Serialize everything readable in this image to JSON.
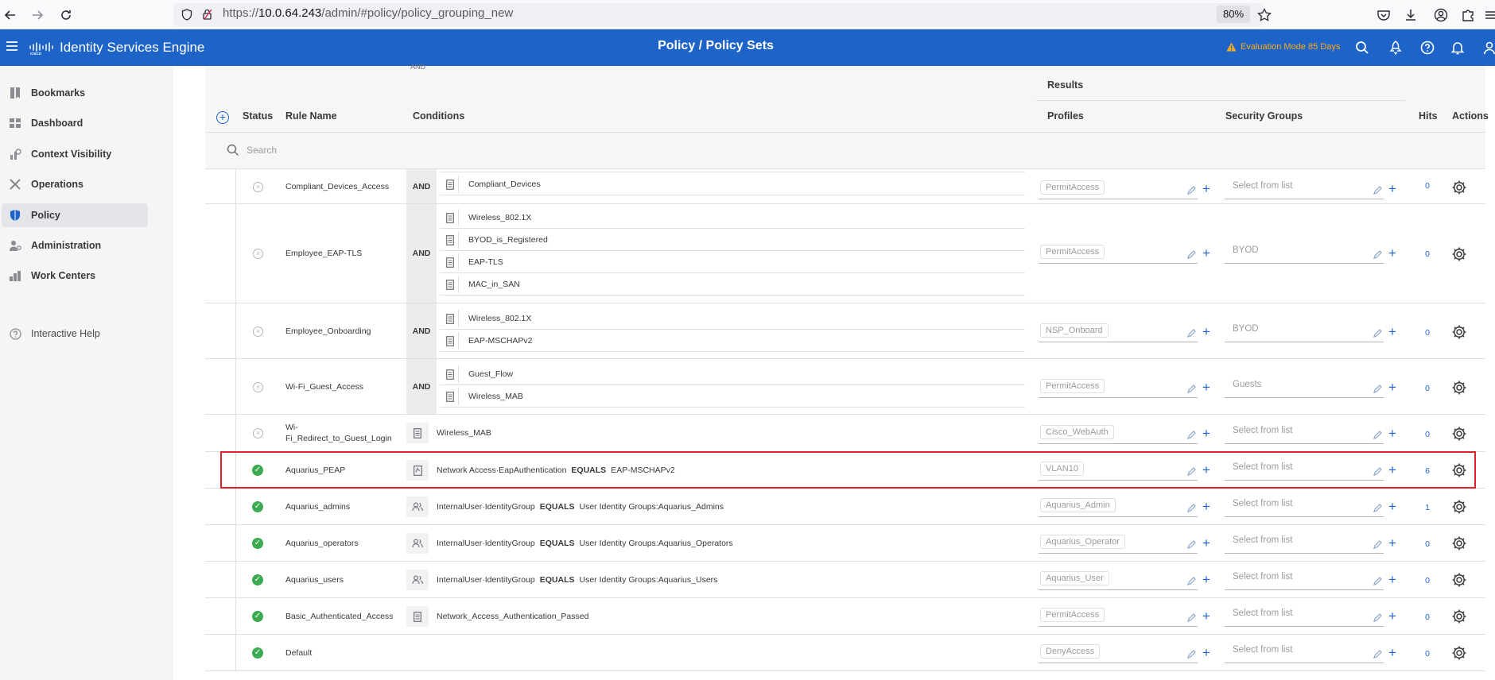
{
  "browser": {
    "url_prefix": "https://",
    "url_host": "10.0.64.243",
    "url_path": "/admin/#policy/policy_grouping_new",
    "zoom": "80%"
  },
  "header": {
    "app_title": "Identity Services Engine",
    "page_title": "Policy / Policy Sets",
    "evaluation": "Evaluation Mode 85 Days"
  },
  "sidebar": {
    "items": [
      {
        "label": "Bookmarks"
      },
      {
        "label": "Dashboard"
      },
      {
        "label": "Context Visibility"
      },
      {
        "label": "Operations"
      },
      {
        "label": "Policy"
      },
      {
        "label": "Administration"
      },
      {
        "label": "Work Centers"
      }
    ],
    "help_label": "Interactive Help"
  },
  "table": {
    "partial_top_text": "AND",
    "headers": {
      "results": "Results",
      "status": "Status",
      "rule_name": "Rule Name",
      "conditions": "Conditions",
      "profiles": "Profiles",
      "security_groups": "Security Groups",
      "hits": "Hits",
      "actions": "Actions"
    },
    "search_placeholder": "Search",
    "rows": [
      {
        "name": "Compliant_Devices_Access",
        "conditions": [
          "Compliant_Devices"
        ],
        "profile": "PermitAccess",
        "sg": "Select from list",
        "hits": "0"
      },
      {
        "name": "Employee_EAP-TLS",
        "conditions": [
          "Wireless_802.1X",
          "BYOD_is_Registered",
          "EAP-TLS",
          "MAC_in_SAN"
        ],
        "profile": "PermitAccess",
        "sg": "BYOD",
        "hits": "0"
      },
      {
        "name": "Employee_Onboarding",
        "conditions": [
          "Wireless_802.1X",
          "EAP-MSCHAPv2"
        ],
        "profile": "NSP_Onboard",
        "sg": "BYOD",
        "hits": "0"
      },
      {
        "name": "Wi-Fi_Guest_Access",
        "conditions": [
          "Guest_Flow",
          "Wireless_MAB"
        ],
        "profile": "PermitAccess",
        "sg": "Guests",
        "hits": "0"
      },
      {
        "name_line1": "Wi-",
        "name_line2": "Fi_Redirect_to_Guest_Login",
        "condition": "Wireless_MAB",
        "profile": "Cisco_WebAuth",
        "sg": "Select from list",
        "hits": "0"
      },
      {
        "name": "Aquarius_PEAP",
        "cond_attr": "Network Access·EapAuthentication",
        "cond_op": "EQUALS",
        "cond_val": "EAP-MSCHAPv2",
        "profile": "VLAN10",
        "sg": "Select from list",
        "hits": "6"
      },
      {
        "name": "Aquarius_admins",
        "cond_attr": "InternalUser·IdentityGroup",
        "cond_op": "EQUALS",
        "cond_val": "User Identity Groups:Aquarius_Admins",
        "profile": "Aquarius_Admin",
        "sg": "Select from list",
        "hits": "1"
      },
      {
        "name": "Aquarius_operators",
        "cond_attr": "InternalUser·IdentityGroup",
        "cond_op": "EQUALS",
        "cond_val": "User Identity Groups:Aquarius_Operators",
        "profile": "Aquarius_Operator",
        "sg": "Select from list",
        "hits": "0"
      },
      {
        "name": "Aquarius_users",
        "cond_attr": "InternalUser·IdentityGroup",
        "cond_op": "EQUALS",
        "cond_val": "User Identity Groups:Aquarius_Users",
        "profile": "Aquarius_User",
        "sg": "Select from list",
        "hits": "0"
      },
      {
        "name": "Basic_Authenticated_Access",
        "condition": "Network_Access_Authentication_Passed",
        "profile": "PermitAccess",
        "sg": "Select from list",
        "hits": "0"
      },
      {
        "name": "Default",
        "profile": "DenyAccess",
        "sg": "Select from list",
        "hits": "0"
      }
    ]
  },
  "colors": {
    "header_blue": "#1e64c8",
    "highlight_red": "#e0202a",
    "status_green": "#3dab51",
    "warning_orange": "#fbab18"
  }
}
